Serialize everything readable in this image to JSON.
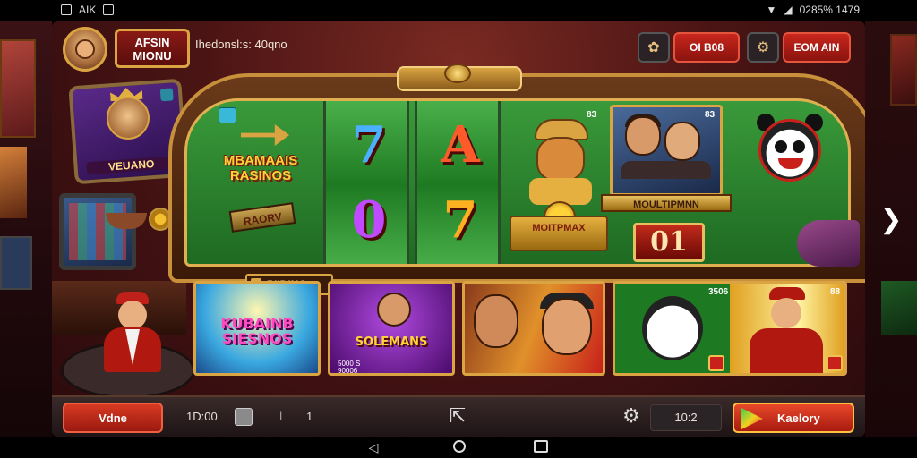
{
  "status_bar": {
    "left_text": "AIK",
    "right_text": "0285% 1479"
  },
  "header": {
    "title_line1": "AFSIN",
    "title_line2": "MIONU",
    "subtitle": "Ihedonsl:s: 40qno",
    "icon_button_1": "flower-icon",
    "button_1_label": "OI B08",
    "icon_button_2": "gear-icon",
    "button_2_label": "EOM AIN"
  },
  "left_cabinet": {
    "label": "VEUANO"
  },
  "slot": {
    "logo_line1": "MBAMAAIS",
    "logo_line2": "RASINOS",
    "logo_sub": "RAORV",
    "reel_1_top": "7",
    "reel_1_bottom": "0",
    "reel_2_top": "A",
    "reel_2_bottom": "7",
    "reel_3_num": "83",
    "coin_plate_label": "MOITPMAX",
    "duo_num": "83",
    "duo_label": "MOULTIPMNN",
    "chip_text": "01",
    "prize_tag": "PIIDING"
  },
  "cards": [
    {
      "line1": "KUBAINB",
      "line2": "SIESNOS"
    },
    {
      "label": "SOLEMANS",
      "small_line1": "5000 S",
      "small_line2": "90006"
    },
    {
      "label": ""
    },
    {
      "num_1": "3506",
      "num_2": "88"
    }
  ],
  "bottom_bar": {
    "left_button": "Vdne",
    "balance_text": "1D:00",
    "separator": "I",
    "count": "1",
    "level": "10:2",
    "right_button": "Kaelory"
  },
  "colors": {
    "accent_red": "#c8261c",
    "gold": "#d9a441",
    "felt_green": "#2a8a2e"
  }
}
